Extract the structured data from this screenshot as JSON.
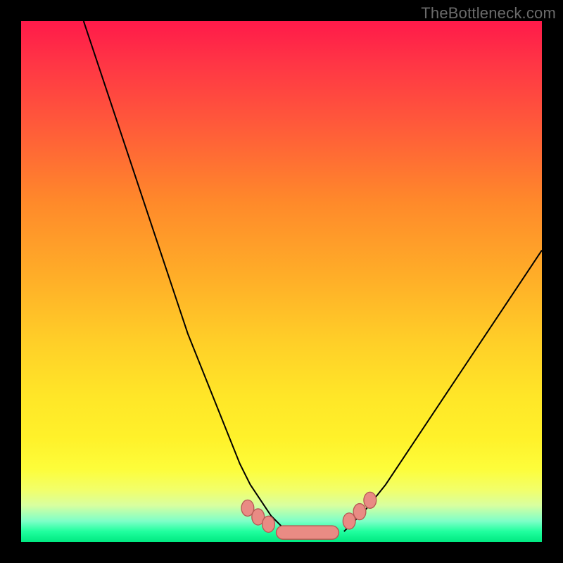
{
  "attribution": "TheBottleneck.com",
  "colors": {
    "frame": "#000000",
    "curve_stroke": "#000000",
    "marker_fill": "#e98b84",
    "marker_stroke": "#b65a54"
  },
  "chart_data": {
    "type": "line",
    "title": "",
    "xlabel": "",
    "ylabel": "",
    "xlim": [
      0,
      100
    ],
    "ylim": [
      0,
      100
    ],
    "grid": false,
    "legend": false,
    "series": [
      {
        "name": "left-curve",
        "x": [
          12,
          16,
          20,
          24,
          28,
          32,
          36,
          40,
          42,
          44,
          46,
          48,
          50,
          52
        ],
        "y": [
          100,
          88,
          76,
          64,
          52,
          40,
          30,
          20,
          15,
          11,
          8,
          5,
          3,
          2
        ]
      },
      {
        "name": "right-curve",
        "x": [
          62,
          64,
          66,
          70,
          74,
          80,
          86,
          92,
          98,
          100
        ],
        "y": [
          2,
          4,
          6,
          11,
          17,
          26,
          35,
          44,
          53,
          56
        ]
      }
    ],
    "markers": [
      {
        "x": 43.5,
        "y": 6.5,
        "r": 1.2
      },
      {
        "x": 45.5,
        "y": 4.8,
        "r": 1.2
      },
      {
        "x": 47.5,
        "y": 3.4,
        "r": 1.2
      },
      {
        "x": 63.0,
        "y": 4.0,
        "r": 1.2
      },
      {
        "x": 65.0,
        "y": 5.8,
        "r": 1.2
      },
      {
        "x": 67.0,
        "y": 8.0,
        "r": 1.2
      }
    ],
    "flat_segment": {
      "x_start": 49,
      "x_end": 61,
      "y": 1.8,
      "thickness": 2.6
    }
  }
}
